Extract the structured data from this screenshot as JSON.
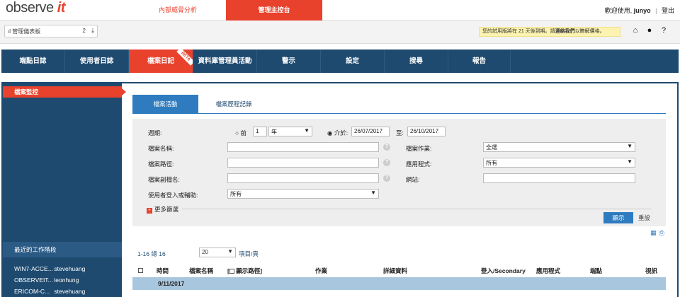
{
  "header": {
    "logo_text": "observe",
    "logo_accent": "it",
    "tabs": [
      "內部威脅分析",
      "管理主控台"
    ],
    "welcome": "歡迎使用,",
    "user": "junyo",
    "logout": "登出"
  },
  "subbar": {
    "dashboard": "管理儀表板",
    "dashboard_count": "2",
    "trial_text": "您的試用版將在 21 天後到期。請",
    "trial_link": "連絡我們",
    "trial_tail": "以瞭解價格。",
    "icons": [
      "home-icon",
      "lightbulb-icon",
      "help-icon"
    ]
  },
  "nav": {
    "items": [
      "端點日誌",
      "使用者日誌",
      "檔案日記",
      "資料庫管理員活動",
      "警示",
      "設定",
      "搜尋",
      "報告"
    ],
    "beta": "BETA"
  },
  "sidebar": {
    "active": "檔案監控",
    "recent_title": "最近的工作階段",
    "sessions": [
      {
        "host": "WIN7-ACCE...",
        "user": "stevehuang"
      },
      {
        "host": "OBSERVEIT...",
        "user": "leonhung"
      },
      {
        "host": "ERICOM-C...",
        "user": "stevehuang"
      }
    ]
  },
  "tabs": [
    "檔案活動",
    "檔案歷程記錄"
  ],
  "filter": {
    "period_label": "週期:",
    "prev_label": "前",
    "prev_value": "1",
    "prev_unit": "年",
    "between_label": "介於:",
    "date_from": "26/07/2017",
    "to_label": "至:",
    "date_to": "26/10/2017",
    "filename_label": "檔案名稱:",
    "filepath_label": "檔案路徑:",
    "ext_label": "檔案副檔名:",
    "login_label": "使用者登入或輔助:",
    "login_value": "所有",
    "op_label": "檔案作業:",
    "op_value": "全選",
    "app_label": "應用程式:",
    "app_value": "所有",
    "site_label": "網站:",
    "more_label": "更多篩選",
    "show_btn": "顯示",
    "reset_btn": "重設"
  },
  "paging": {
    "summary": "1-16 總 16",
    "per_page": "20",
    "per_page_label": "項目/頁"
  },
  "table": {
    "columns": [
      "時間",
      "檔案名稱",
      "顯示路徑",
      "作業",
      "詳細資料",
      "登入/Secondary",
      "應用程式",
      "端點",
      "視訊"
    ],
    "date_group": "9/11/2017"
  }
}
